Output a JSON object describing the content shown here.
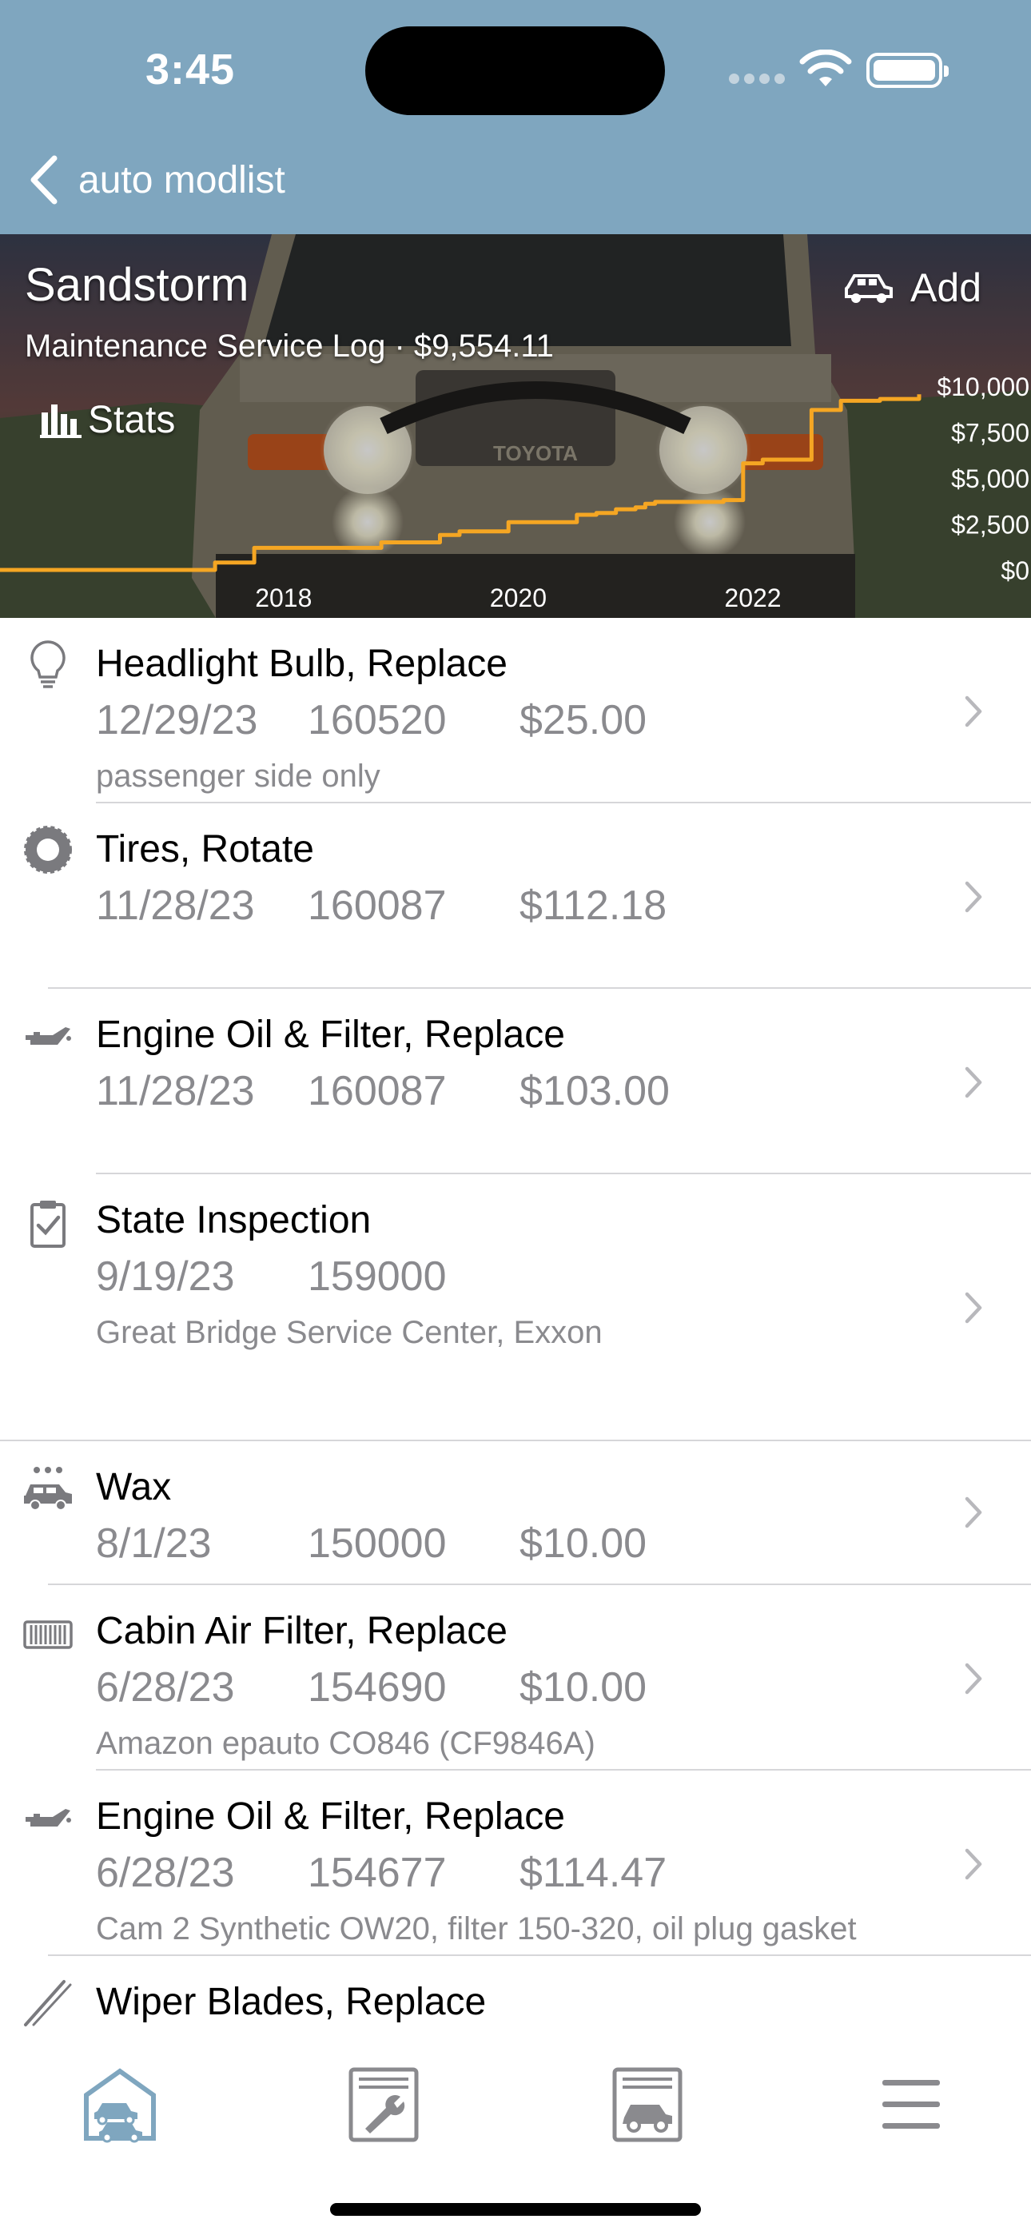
{
  "status_bar": {
    "time": "3:45"
  },
  "nav": {
    "back_label": "auto modlist"
  },
  "header": {
    "vehicle_name": "Sandstorm",
    "subtitle": "Maintenance Service Log · $9,554.11",
    "stats_label": "Stats",
    "add_label": "Add"
  },
  "chart_data": {
    "type": "line",
    "title": "",
    "series": [
      {
        "name": "",
        "x": [
          "2016-02",
          "2017-12",
          "2018-03",
          "2018-04",
          "2019-05",
          "2019-06",
          "2019-11",
          "2020-01",
          "2020-06",
          "2021-01",
          "2021-03",
          "2021-05",
          "2021-07",
          "2021-08",
          "2021-09",
          "2022-04",
          "2022-06",
          "2022-08",
          "2022-09",
          "2023-01",
          "2023-04",
          "2023-08",
          "2023-12"
        ],
        "values": [
          0,
          400,
          400,
          1200,
          1500,
          1500,
          1900,
          2100,
          2600,
          3000,
          3100,
          3300,
          3400,
          3600,
          3700,
          3800,
          5800,
          6000,
          6000,
          8700,
          9200,
          9300,
          9554.11
        ]
      }
    ],
    "x_ticks": [
      "2018",
      "2020",
      "2022"
    ],
    "y_ticks": [
      "$10,000",
      "$7,500",
      "$5,000",
      "$2,500",
      "$0"
    ],
    "ylim": [
      0,
      10000
    ],
    "line_color": "#f5a623",
    "grid": false
  },
  "entries": [
    {
      "icon": "lightbulb-icon",
      "title": "Headlight Bulb, Replace",
      "date": "12/29/23",
      "miles": "160520",
      "cost": "$25.00",
      "note": "passenger side only"
    },
    {
      "icon": "tire-icon",
      "title": "Tires, Rotate",
      "date": "11/28/23",
      "miles": "160087",
      "cost": "$112.18",
      "note": ""
    },
    {
      "icon": "oil-can-icon",
      "title": "Engine Oil & Filter, Replace",
      "date": "11/28/23",
      "miles": "160087",
      "cost": "$103.00",
      "note": ""
    },
    {
      "icon": "clipboard-check-icon",
      "title": "State Inspection",
      "date": "9/19/23",
      "miles": "159000",
      "cost": "",
      "note": "Great Bridge Service Center, Exxon"
    },
    {
      "icon": "car-wash-icon",
      "title": "Wax",
      "date": "8/1/23",
      "miles": "150000",
      "cost": "$10.00",
      "note": ""
    },
    {
      "icon": "air-filter-icon",
      "title": "Cabin Air Filter, Replace",
      "date": "6/28/23",
      "miles": "154690",
      "cost": "$10.00",
      "note": "Amazon epauto CO846 (CF9846A)"
    },
    {
      "icon": "oil-can-icon",
      "title": "Engine Oil & Filter, Replace",
      "date": "6/28/23",
      "miles": "154677",
      "cost": "$114.47",
      "note": "Cam 2 Synthetic OW20, filter 150-320, oil plug gasket"
    },
    {
      "icon": "wiper-blade-icon",
      "title": "Wiper Blades, Replace",
      "date": "",
      "miles": "",
      "cost": "",
      "note": ""
    }
  ],
  "tabbar": {
    "tabs": [
      {
        "icon": "garage-icon",
        "active": true
      },
      {
        "icon": "service-log-icon",
        "active": false
      },
      {
        "icon": "vehicle-card-icon",
        "active": false
      },
      {
        "icon": "menu-icon",
        "active": false
      }
    ],
    "active_color": "#7fa6bf",
    "inactive_color": "#8a8a8e"
  }
}
